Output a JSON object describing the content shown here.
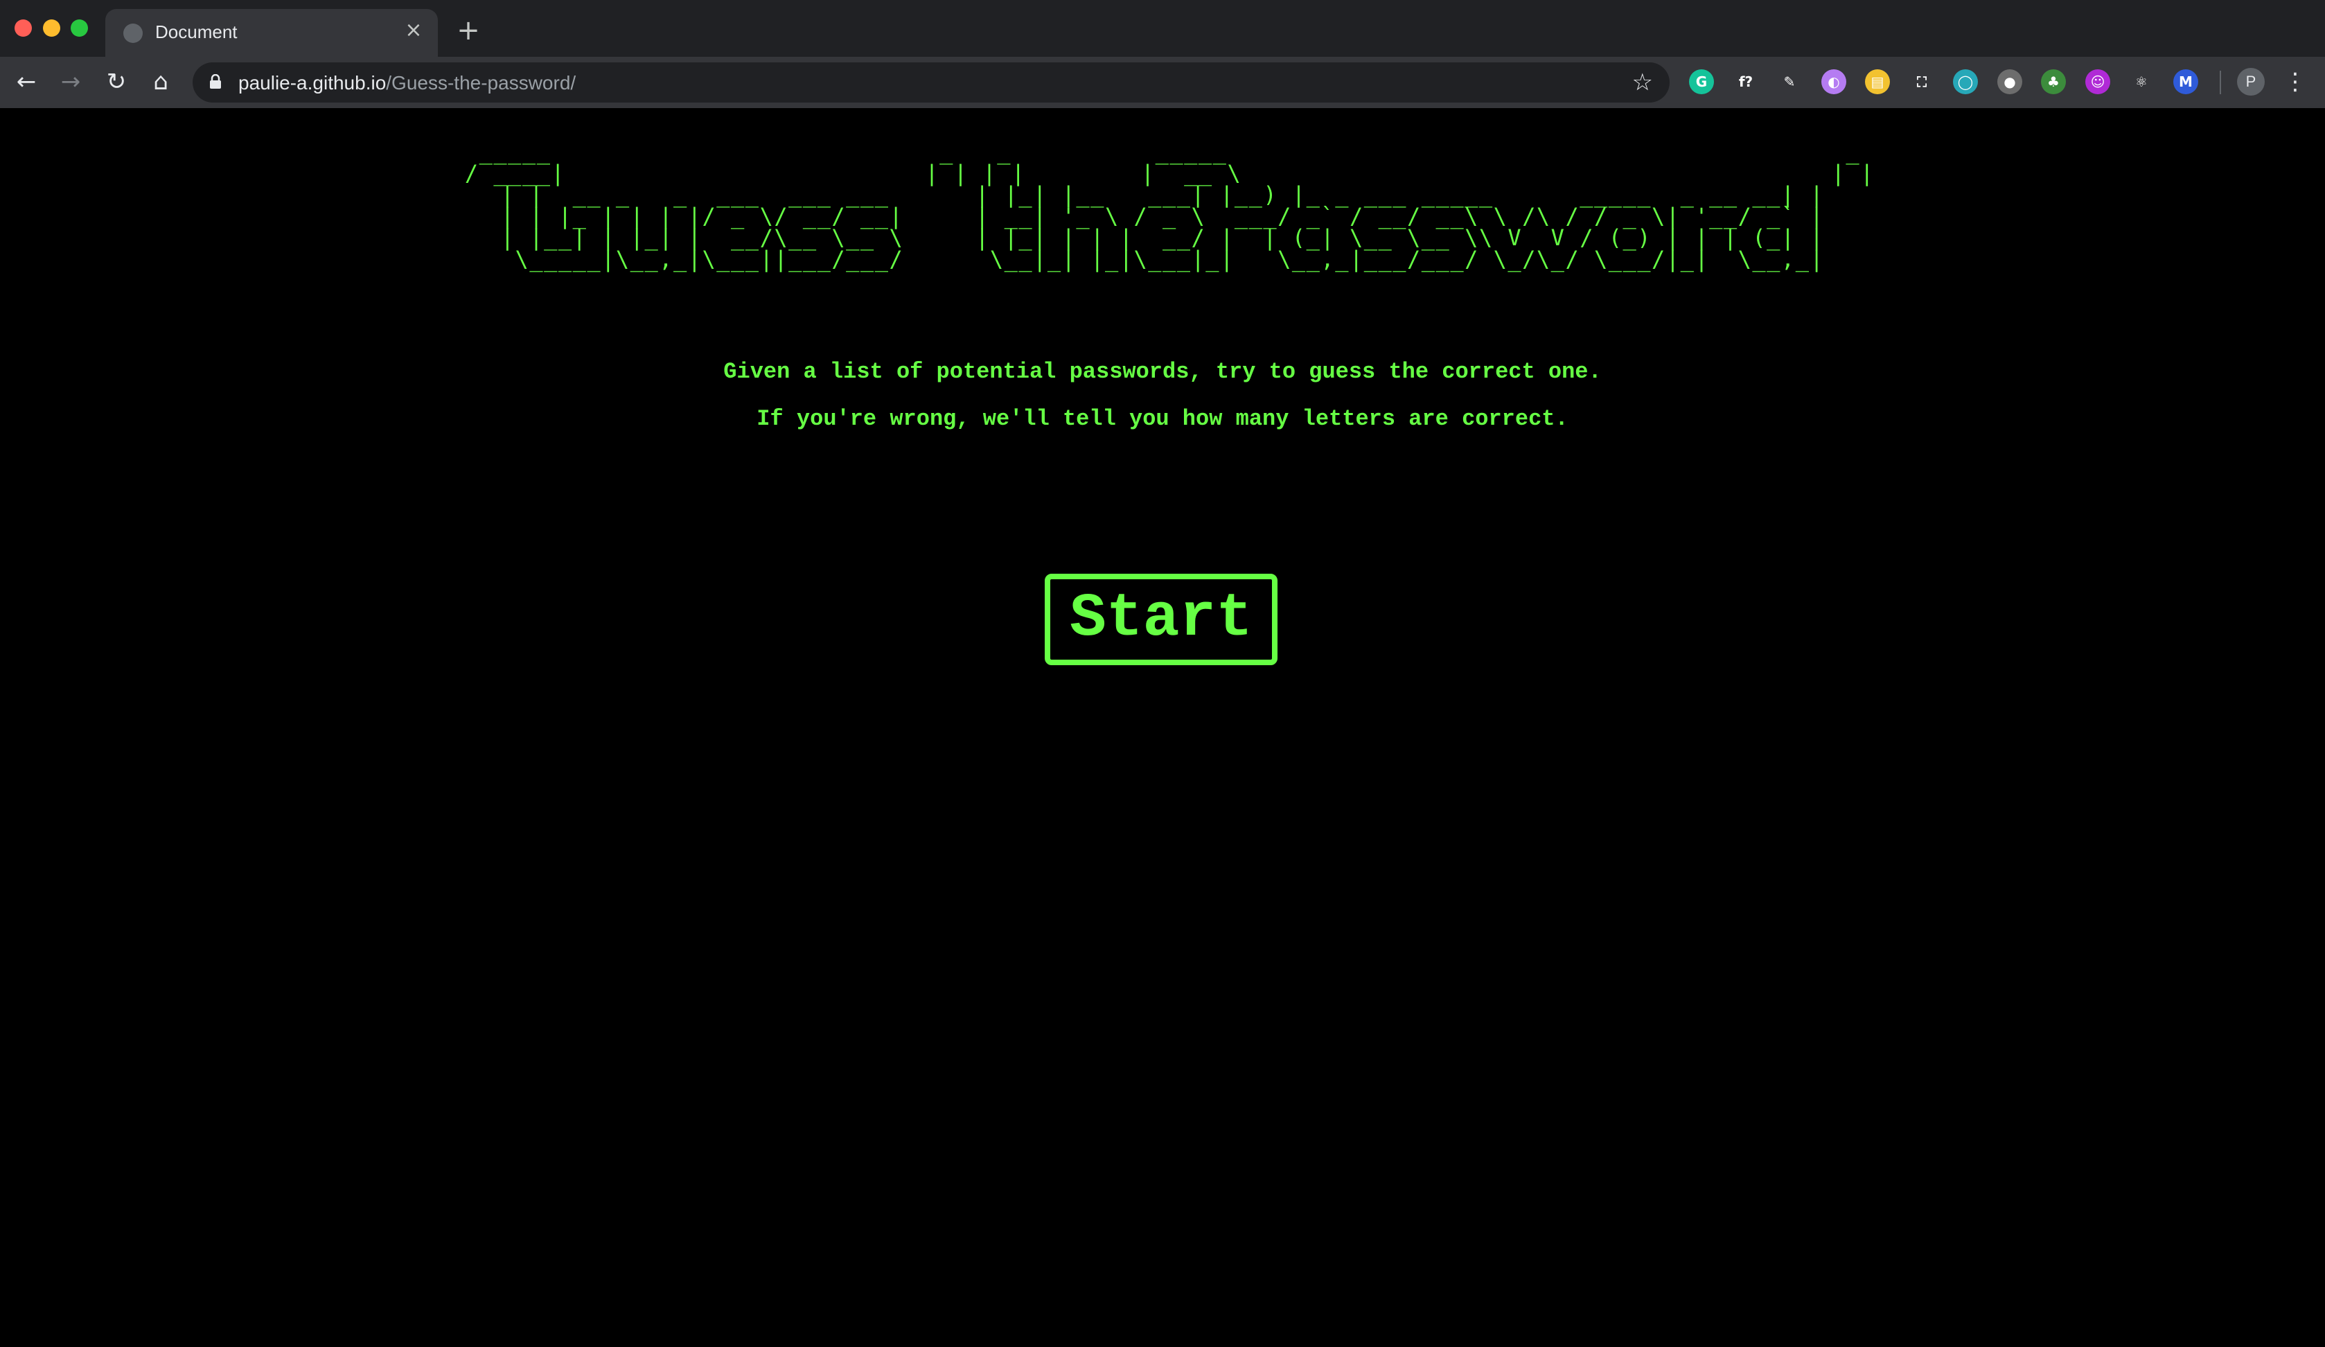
{
  "browser": {
    "tab_title": "Document",
    "tab_close_symbol": "×",
    "new_tab_symbol": "+",
    "url_host": "paulie-a.github.io",
    "url_path": "/Guess-the-password/",
    "back_symbol": "←",
    "forward_symbol": "→",
    "reload_symbol": "↻",
    "home_symbol": "⌂",
    "bookmark_symbol": "☆",
    "menu_symbol": "⋮",
    "profile_initial": "P",
    "extensions": [
      {
        "name": "grammarly-extension-icon",
        "glyph": "G",
        "color": "#15c39a"
      },
      {
        "name": "formula-extension-icon",
        "glyph": "f?",
        "color": "#35363a"
      },
      {
        "name": "pen-extension-icon",
        "glyph": "✎",
        "color": "#35363a"
      },
      {
        "name": "color-picker-extension-icon",
        "glyph": "◐",
        "color": "#b57cf2"
      },
      {
        "name": "notes-extension-icon",
        "glyph": "▤",
        "color": "#f2c230"
      },
      {
        "name": "screenshot-extension-icon",
        "glyph": "⛶",
        "color": "#35363a"
      },
      {
        "name": "circle-extension-icon",
        "glyph": "◯",
        "color": "#27a8b8"
      },
      {
        "name": "bulb-extension-icon",
        "glyph": "●",
        "color": "#6d6d6d"
      },
      {
        "name": "tree-extension-icon",
        "glyph": "♣",
        "color": "#3c8c3c"
      },
      {
        "name": "face-extension-icon",
        "glyph": "☺",
        "color": "#b02ad6"
      },
      {
        "name": "react-extension-icon",
        "glyph": "⚛",
        "color": "#35363a"
      },
      {
        "name": "m-extension-icon",
        "glyph": "M",
        "color": "#2f5bd9"
      }
    ]
  },
  "page": {
    "title_ascii": "  _____                           _   _          _____                                           _ \n / ____|                         | | | |        |  __ \\                                         | |\n| |  __ _   _  ___  ___ ___      | |_| |__   ___| |__) |_ _ ___ _____      _____  _ __ __| |\n| | |_ | | | |/ _ \\/ __/ __|     | __| '_ \\ / _ \\  ___/ _` / __/ __\\ \\ /\\ / / _ \\| '__/ _` |\n| |__| | |_| |  __/\\__ \\__ \\     | |_| | | |  __/ |  | (_| \\__ \\__ \\\\ V  V / (_) | | | (_| |\n \\_____|\\__,_|\\___||___/___/      \\__|_| |_|\\___|_|   \\__,_|___/___/ \\_/\\_/ \\___/|_|  \\__,_|",
    "intro_line1": "Given a list of potential passwords, try to guess the correct one.",
    "intro_line2": "If you're wrong, we'll tell you how many letters are correct.",
    "start_label": "Start",
    "accent_color": "#66ff44",
    "background_color": "#000000"
  }
}
